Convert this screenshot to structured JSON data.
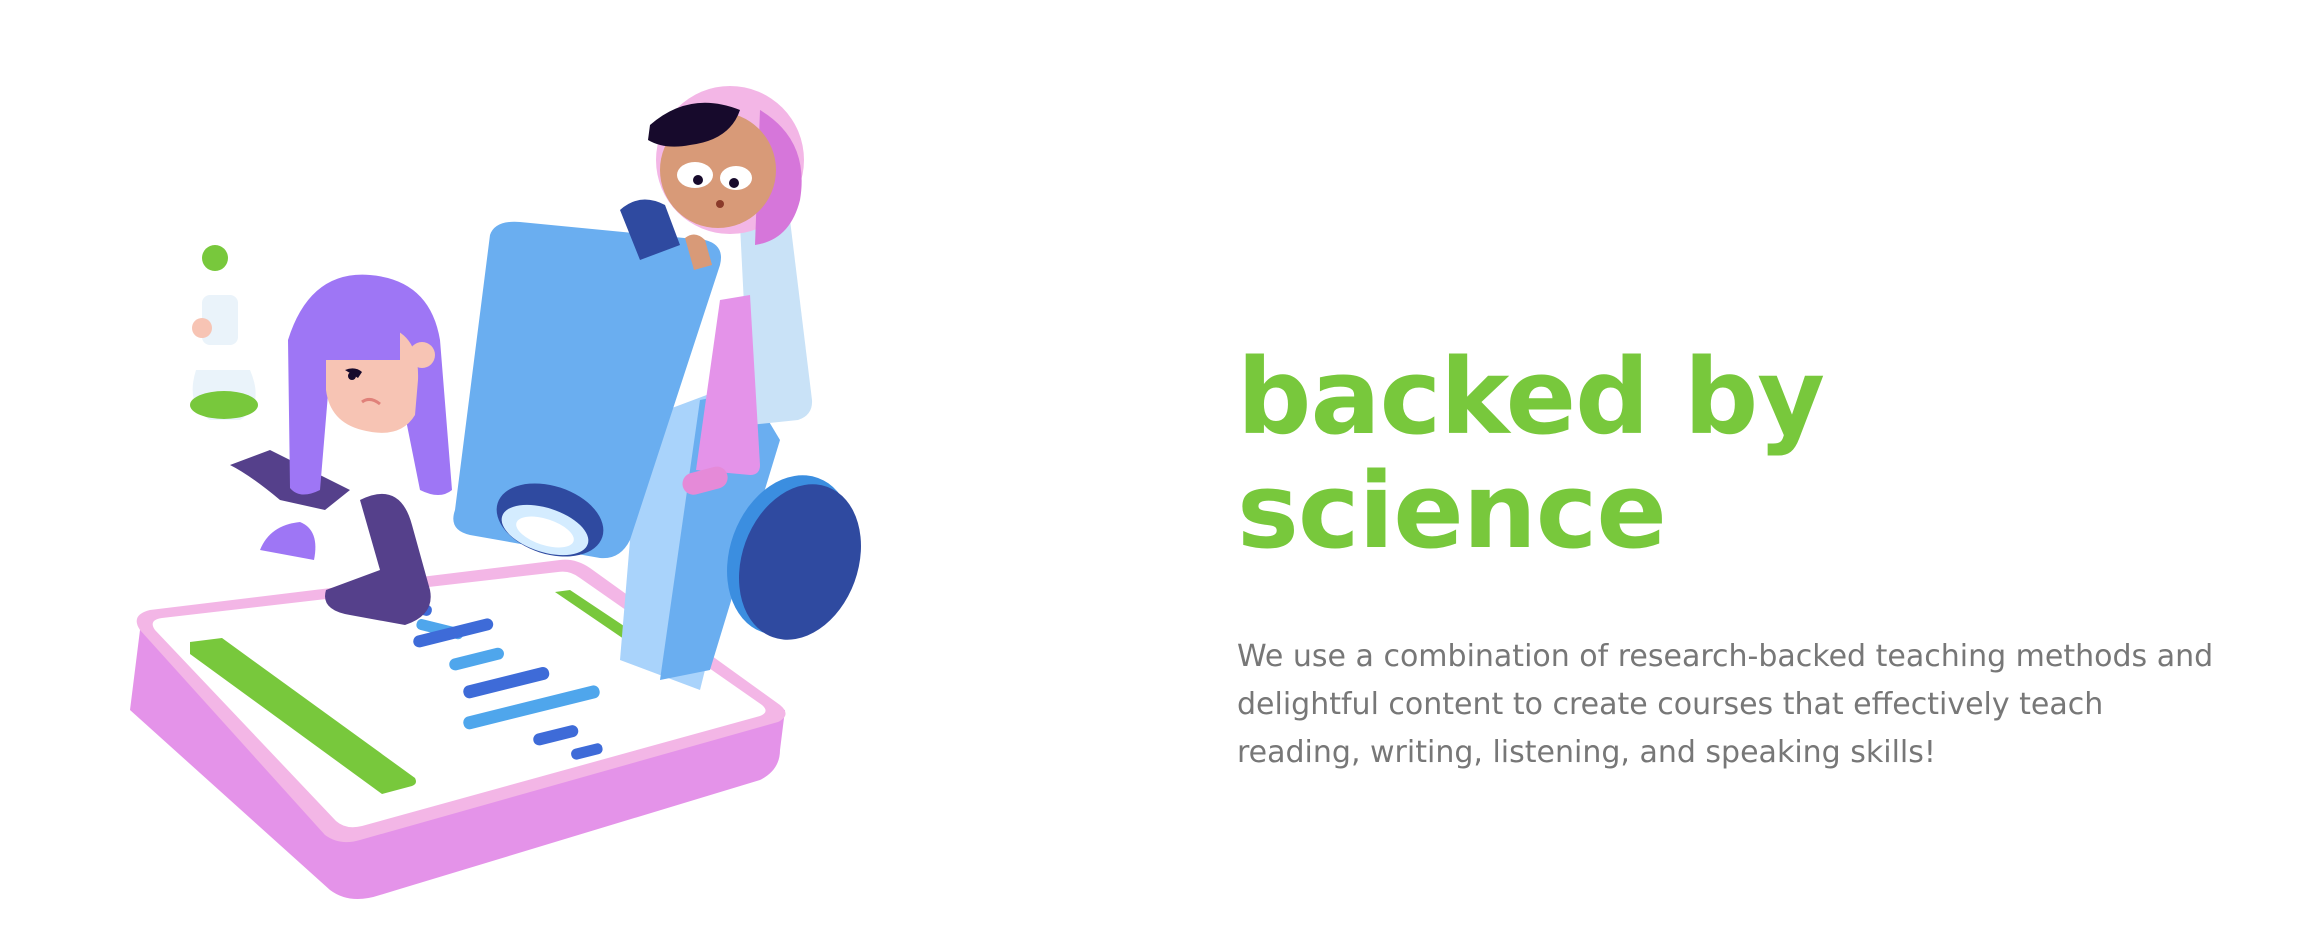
{
  "section": {
    "headline": "backed by science",
    "body": "We use a combination of research-backed teaching methods and delightful content to create courses that effectively teach reading, writing, listening, and speaking skills!"
  },
  "illustration": {
    "description_icon": "scientists-with-microscope-illustration"
  },
  "colors": {
    "headline_green": "#78c83c",
    "body_gray": "#777777",
    "pink_base": "#e493e9",
    "microscope_blue": "#6aaef0",
    "dark_blue": "#2f4aa0",
    "purple_hair": "#9e76f5"
  }
}
